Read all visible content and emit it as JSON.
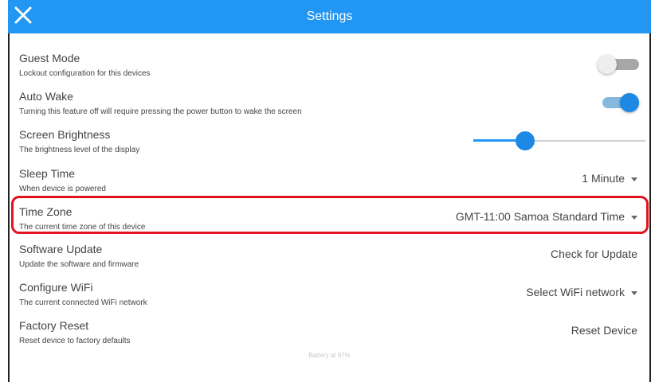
{
  "header": {
    "title": "Settings",
    "close_icon": "close-icon",
    "accent_color": "#2196f3"
  },
  "settings": {
    "guest_mode": {
      "label": "Guest Mode",
      "description": "Lockout configuration for this devices",
      "enabled": false
    },
    "auto_wake": {
      "label": "Auto Wake",
      "description": "Turning this feature off will require pressing the power button to wake the screen",
      "enabled": true
    },
    "screen_brightness": {
      "label": "Screen Brightness",
      "description": "The brightness level of the display",
      "level": 0.3
    },
    "sleep_time": {
      "label": "Sleep Time",
      "description": "When device is powered",
      "value": "1 Minute"
    },
    "time_zone": {
      "label": "Time Zone",
      "description": "The current time zone of this device",
      "value": "GMT-11:00 Samoa Standard Time"
    },
    "software_update": {
      "label": "Software Update",
      "description": "Update the software and firmware",
      "action": "Check for Update"
    },
    "configure_wifi": {
      "label": "Configure WiFi",
      "description": "The current connected WiFi network",
      "value": "Select WiFi network"
    },
    "factory_reset": {
      "label": "Factory Reset",
      "description": "Reset device to factory defaults",
      "action": "Reset Device"
    }
  },
  "status": {
    "battery": "Battery at 97%"
  },
  "highlight_color": "#e0141e"
}
